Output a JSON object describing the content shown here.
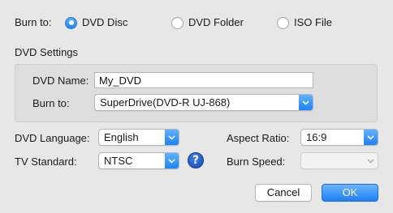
{
  "burn_to_row": {
    "label": "Burn to:",
    "options": [
      {
        "label": "DVD Disc",
        "selected": true
      },
      {
        "label": "DVD Folder",
        "selected": false
      },
      {
        "label": "ISO File",
        "selected": false
      }
    ]
  },
  "dvd_settings": {
    "section_title": "DVD Settings",
    "dvd_name_label": "DVD Name:",
    "dvd_name_value": "My_DVD",
    "burn_to_label": "Burn to:",
    "burn_to_value": "SuperDrive(DVD-R   UJ-868)"
  },
  "options": {
    "language_label": "DVD Language:",
    "language_value": "English",
    "tv_standard_label": "TV Standard:",
    "tv_standard_value": "NTSC",
    "aspect_ratio_label": "Aspect Ratio:",
    "aspect_ratio_value": "16:9",
    "burn_speed_label": "Burn Speed:",
    "burn_speed_value": ""
  },
  "buttons": {
    "cancel": "Cancel",
    "ok": "OK"
  },
  "icons": {
    "help": "?",
    "help_name": "help-icon",
    "dropdown": "chevron-down-icon"
  },
  "colors": {
    "accent": "#1a82fb",
    "help": "#1749b5",
    "background": "#e7e7e7"
  }
}
